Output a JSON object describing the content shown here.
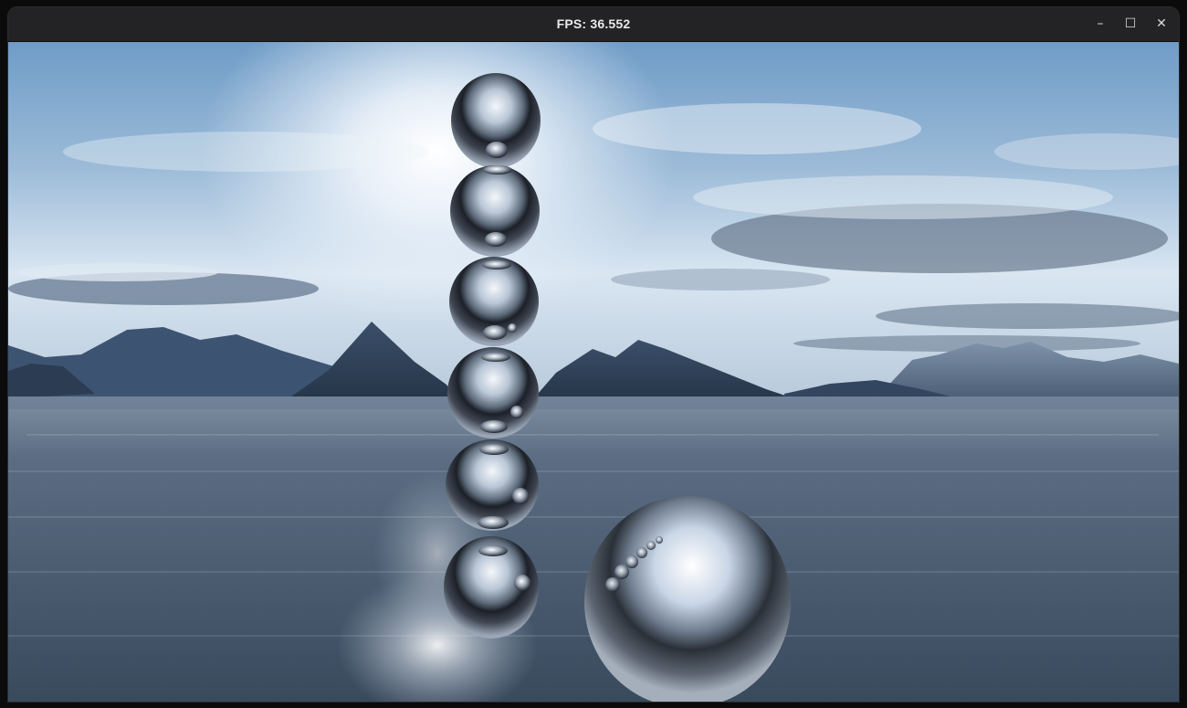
{
  "window": {
    "title": "FPS: 36.552",
    "controls": {
      "minimize": "–",
      "maximize": "☐",
      "close": "✕"
    }
  },
  "scene": {
    "icons": {
      "minimize": "minimize-icon",
      "maximize": "maximize-icon",
      "close": "close-icon"
    },
    "colors": {
      "titlebar": "#232325",
      "sky_top": "#6f9cc7",
      "sky_bright": "#e8f1fb",
      "water": "#4f6177",
      "mountain": "#31455e"
    }
  }
}
